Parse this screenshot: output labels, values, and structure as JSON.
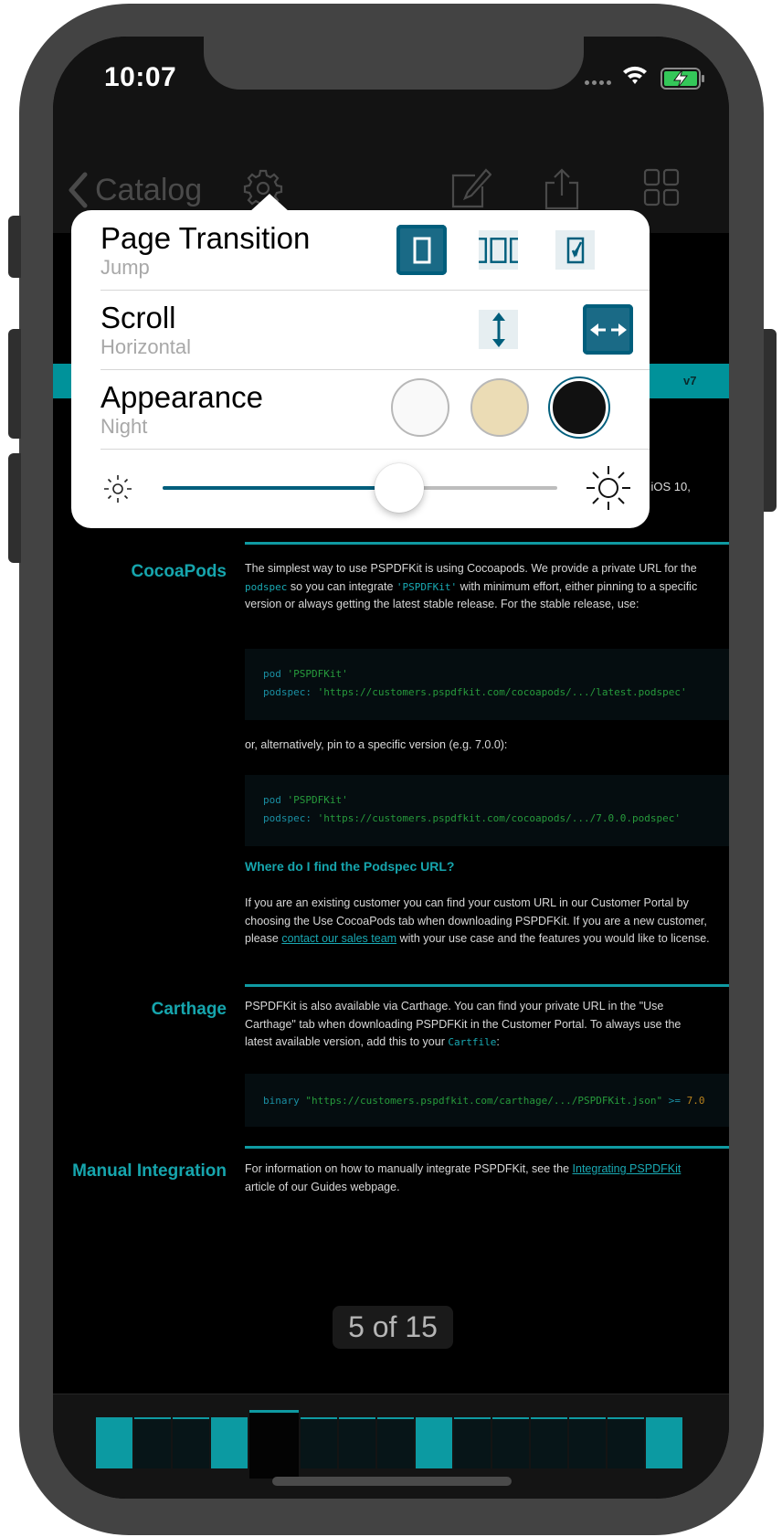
{
  "status_bar": {
    "time": "10:07"
  },
  "navbar": {
    "back_label": "Catalog",
    "icons": [
      "chevron-left-icon",
      "gear-icon",
      "annotate-icon",
      "share-icon",
      "grid-icon"
    ]
  },
  "popover": {
    "page_transition": {
      "title": "Page Transition",
      "value": "Jump",
      "options": [
        "jump",
        "continuous",
        "curl"
      ],
      "selected_index": 0
    },
    "scroll": {
      "title": "Scroll",
      "value": "Horizontal",
      "options": [
        "vertical",
        "horizontal"
      ],
      "selected_index": 1
    },
    "appearance": {
      "title": "Appearance",
      "value": "Night",
      "options": [
        {
          "name": "default",
          "color": "#f9f9f9"
        },
        {
          "name": "sepia",
          "color": "#ebdcb5"
        },
        {
          "name": "night",
          "color": "#111111"
        }
      ],
      "selected_index": 2
    },
    "brightness": {
      "value_fraction": 0.6,
      "accent_color": "#005e7c"
    }
  },
  "document": {
    "header_badge": "v7",
    "partial_text": "9, iOS 10,",
    "sections": [
      {
        "title": "CocoaPods",
        "paragraphs": [
          {
            "parts": [
              {
                "t": "The simplest way to use PSPDFKit is using Cocoapods. We provide a private URL for the "
              },
              {
                "t": "podspec",
                "style": "code"
              },
              {
                "t": " so you can integrate "
              },
              {
                "t": "'PSPDFKit'",
                "style": "code"
              },
              {
                "t": " with minimum effort, either pinning to a specific version or always getting the latest stable release. For the stable release, use:"
              }
            ]
          }
        ],
        "code_blocks": [
          {
            "lines": [
              [
                {
                  "t": "pod ",
                  "c": "kw"
                },
                {
                  "t": "'PSPDFKit'",
                  "c": "str"
                }
              ],
              [
                {
                  "t": "podspec: ",
                  "c": "kw"
                },
                {
                  "t": "'https://customers.pspdfkit.com/cocoapods/.../latest.podspec'",
                  "c": "str"
                }
              ]
            ]
          },
          {
            "lines": [
              [
                {
                  "t": "pod ",
                  "c": "kw"
                },
                {
                  "t": "'PSPDFKit'",
                  "c": "str"
                }
              ],
              [
                {
                  "t": "podspec: ",
                  "c": "kw"
                },
                {
                  "t": "'https://customers.pspdfkit.com/cocoapods/.../7.0.0.podspec'",
                  "c": "str"
                }
              ]
            ]
          }
        ],
        "alt_text": "or, alternatively, pin to a specific version (e.g. 7.0.0):",
        "subheading": "Where do I find the Podspec URL?",
        "sub_paragraph": {
          "parts": [
            {
              "t": "If you are an existing customer you can find your custom URL in our Customer Portal by choosing the Use CocoaPods tab when downloading PSPDFKit. If you are a new customer, please "
            },
            {
              "t": "contact our sales team",
              "style": "link"
            },
            {
              "t": " with your use case and the features you would like to license."
            }
          ]
        }
      },
      {
        "title": "Carthage",
        "paragraph": {
          "parts": [
            {
              "t": "PSPDFKit is also available via Carthage. You can find your private URL in the \"Use Carthage\" tab when downloading PSPDFKit in the Customer Portal. To always use the latest available version, add this to your "
            },
            {
              "t": "Cartfile",
              "style": "code"
            },
            {
              "t": ":"
            }
          ]
        },
        "code_block": {
          "lines": [
            [
              {
                "t": "binary ",
                "c": "kw"
              },
              {
                "t": "\"https://customers.pspdfkit.com/carthage/.../PSPDFKit.json\" ",
                "c": "str"
              },
              {
                "t": ">= ",
                "c": "kw"
              },
              {
                "t": "7.0",
                "c": "num"
              }
            ]
          ]
        }
      },
      {
        "title": "Manual Integration",
        "paragraph": {
          "parts": [
            {
              "t": "For information on how to manually integrate PSPDFKit, see the "
            },
            {
              "t": "Integrating PSPDFKit",
              "style": "link"
            },
            {
              "t": " article of our Guides webpage."
            }
          ]
        }
      }
    ]
  },
  "page_indicator": {
    "label": "5 of 15",
    "current": 5,
    "total": 15
  },
  "thumbnails": {
    "count": 15,
    "current_index": 4,
    "teal_pages": [
      0,
      3,
      8,
      14
    ]
  },
  "colors": {
    "accent": "#005e7c",
    "doc_teal": "#0f9aa2",
    "nav_bg": "#131313"
  }
}
